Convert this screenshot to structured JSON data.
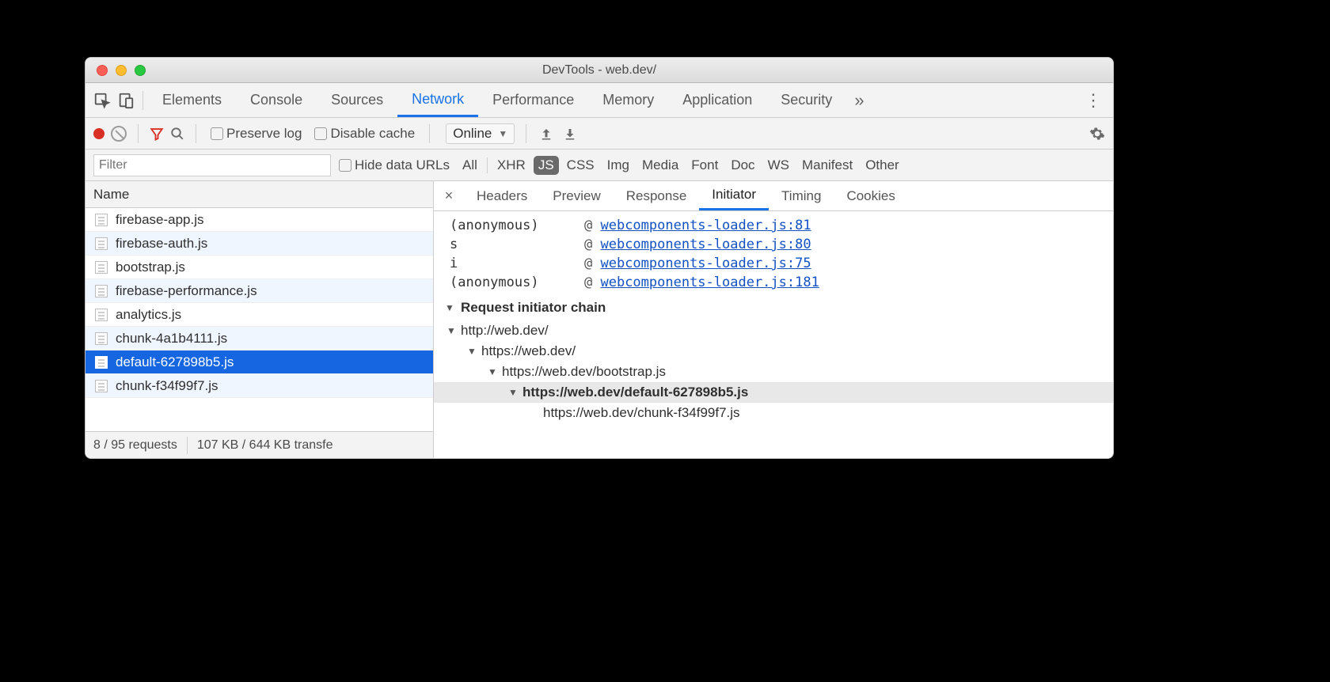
{
  "window": {
    "title": "DevTools - web.dev/"
  },
  "mainTabs": {
    "items": [
      "Elements",
      "Console",
      "Sources",
      "Network",
      "Performance",
      "Memory",
      "Application",
      "Security"
    ],
    "active": "Network",
    "overflowGlyph": "»"
  },
  "netToolbar": {
    "preserveLog": "Preserve log",
    "disableCache": "Disable cache",
    "throttle": "Online"
  },
  "filterRow": {
    "placeholder": "Filter",
    "hideData": "Hide data URLs",
    "types": [
      "All",
      "XHR",
      "JS",
      "CSS",
      "Img",
      "Media",
      "Font",
      "Doc",
      "WS",
      "Manifest",
      "Other"
    ],
    "active": "JS"
  },
  "requests": {
    "columnHeader": "Name",
    "items": [
      "firebase-app.js",
      "firebase-auth.js",
      "bootstrap.js",
      "firebase-performance.js",
      "analytics.js",
      "chunk-4a1b4111.js",
      "default-627898b5.js",
      "chunk-f34f99f7.js"
    ],
    "selected": 6
  },
  "status": {
    "reqCount": "8 / 95 requests",
    "transfer": "107 KB / 644 KB transfe"
  },
  "detailTabs": {
    "items": [
      "Headers",
      "Preview",
      "Response",
      "Initiator",
      "Timing",
      "Cookies"
    ],
    "active": "Initiator"
  },
  "stack": [
    {
      "fn": "(anonymous)",
      "link": "webcomponents-loader.js:81"
    },
    {
      "fn": "s",
      "link": "webcomponents-loader.js:80"
    },
    {
      "fn": "i",
      "link": "webcomponents-loader.js:75"
    },
    {
      "fn": "(anonymous)",
      "link": "webcomponents-loader.js:181"
    }
  ],
  "chain": {
    "heading": "Request initiator chain",
    "nodes": [
      {
        "level": 0,
        "label": "http://web.dev/",
        "caret": true
      },
      {
        "level": 1,
        "label": "https://web.dev/",
        "caret": true
      },
      {
        "level": 2,
        "label": "https://web.dev/bootstrap.js",
        "caret": true
      },
      {
        "level": 3,
        "label": "https://web.dev/default-627898b5.js",
        "caret": true,
        "current": true
      },
      {
        "level": 4,
        "label": "https://web.dev/chunk-f34f99f7.js",
        "caret": false
      }
    ]
  }
}
